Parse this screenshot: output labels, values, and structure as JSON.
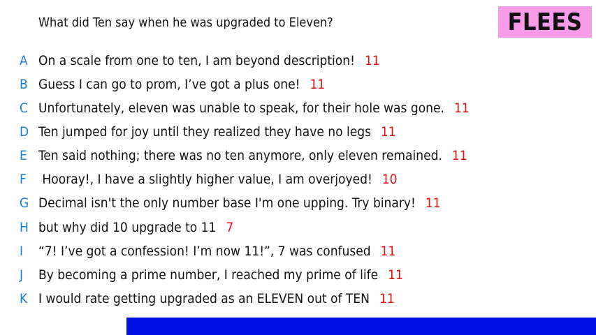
{
  "question": "What did Ten say when he was upgraded to Eleven?",
  "logo": "FLEES",
  "answers": [
    {
      "letter": "A",
      "text": "On a scale from one to ten, I am beyond description!",
      "score": "11"
    },
    {
      "letter": "B",
      "text": "Guess I can go to prom, I’ve got a plus one!",
      "score": "11"
    },
    {
      "letter": "C",
      "text": "Unfortunately, eleven was unable to speak, for their hole was gone.",
      "score": "11"
    },
    {
      "letter": "D",
      "text": "Ten jumped for joy until they realized they have no legs",
      "score": "11"
    },
    {
      "letter": "E",
      "text": "Ten said nothing; there was no ten anymore, only eleven remained.",
      "score": "11"
    },
    {
      "letter": "F",
      "text": " Hooray!, I have a slightly higher value, I am overjoyed!",
      "score": "10"
    },
    {
      "letter": "G",
      "text": "Decimal isn't the only number base I'm one upping. Try binary!",
      "score": "11"
    },
    {
      "letter": "H",
      "text": "but why did 10 upgrade to 11",
      "score": "7"
    },
    {
      "letter": "I",
      "text": "“7! I’ve got a confession! I’m now 11!”, 7 was confused",
      "score": "11"
    },
    {
      "letter": "J",
      "text": "By becoming a prime number, I reached my prime of life",
      "score": "11"
    },
    {
      "letter": "K",
      "text": "I would rate getting upgraded as an ELEVEN out of TEN",
      "score": "11"
    }
  ],
  "colors": {
    "letter": "#1a7fd6",
    "score": "#e01010",
    "logo_bg": "#f59be8",
    "bar": "#0011e6"
  }
}
